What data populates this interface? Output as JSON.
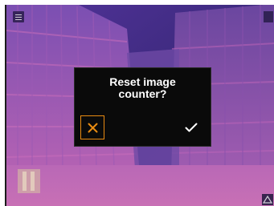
{
  "dialog": {
    "title": "Reset image\ncounter?",
    "cancel_icon": "close-icon",
    "confirm_icon": "check-icon"
  },
  "colors": {
    "accent": "#e88b12",
    "dialog_bg": "#0a0a0a",
    "thermal_primary": "#7a4fb0",
    "thermal_warm": "#c76ab8"
  }
}
